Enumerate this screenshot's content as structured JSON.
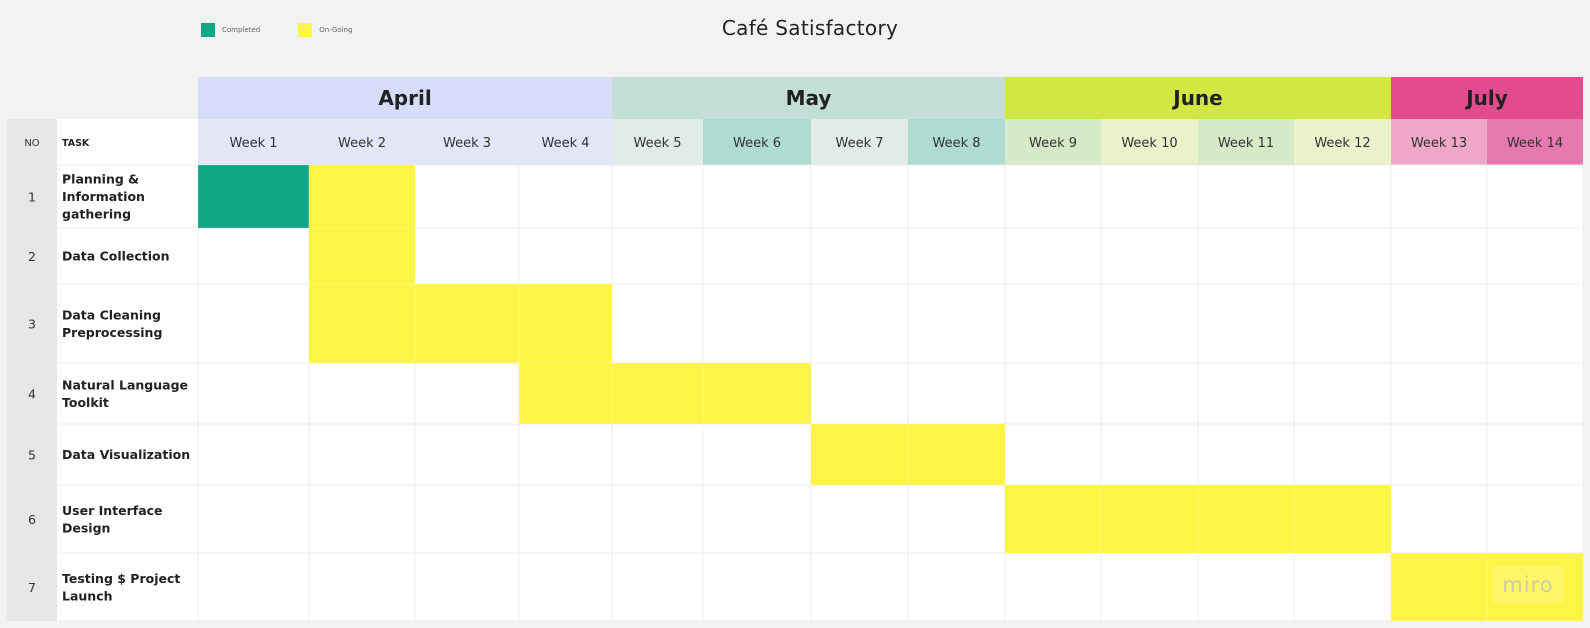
{
  "legend": {
    "completed": {
      "label": "Completed",
      "color": "#0ea886"
    },
    "ongoing": {
      "label": "On-Going",
      "color": "#fef445"
    }
  },
  "chart_data": {
    "type": "gantt",
    "title": "Café Satisfactory",
    "columns": {
      "no": "NO",
      "task": "TASK"
    },
    "months": [
      {
        "name": "April",
        "weeks": 4,
        "color": "#d6dcf9",
        "week_colors": [
          "#e3e6f7",
          "#e3e6f7",
          "#e3e6f7",
          "#e3e6f7"
        ]
      },
      {
        "name": "May",
        "weeks": 4,
        "color": "#c3dfd7",
        "week_colors": [
          "#e1ece8",
          "#aedcd0",
          "#e1ece8",
          "#aedcd0"
        ]
      },
      {
        "name": "June",
        "weeks": 4,
        "color": "#d0e744",
        "week_colors": [
          "#d6eac8",
          "#e9f2cb",
          "#d6eac8",
          "#e9f2cb"
        ]
      },
      {
        "name": "July",
        "weeks": 2,
        "color": "#e24b8f",
        "week_colors": [
          "#eea7c7",
          "#e67aae"
        ]
      }
    ],
    "weeks": [
      "Week 1",
      "Week 2",
      "Week 3",
      "Week 4",
      "Week 5",
      "Week 6",
      "Week 7",
      "Week 8",
      "Week 9",
      "Week 10",
      "Week 11",
      "Week 12",
      "Week 13",
      "Week 14"
    ],
    "tasks": [
      {
        "no": "1",
        "name": "Planning & Information gathering",
        "segments": [
          {
            "status": "completed",
            "weeks": [
              1
            ]
          },
          {
            "status": "ongoing",
            "weeks": [
              2
            ]
          }
        ]
      },
      {
        "no": "2",
        "name": "Data Collection",
        "segments": [
          {
            "status": "ongoing",
            "weeks": [
              2
            ]
          }
        ]
      },
      {
        "no": "3",
        "name": "Data Cleaning Preprocessing",
        "segments": [
          {
            "status": "ongoing",
            "weeks": [
              2,
              3,
              4
            ]
          }
        ]
      },
      {
        "no": "4",
        "name": "Natural Language Toolkit",
        "segments": [
          {
            "status": "ongoing",
            "weeks": [
              4,
              5,
              6
            ]
          }
        ]
      },
      {
        "no": "5",
        "name": "Data Visualization",
        "segments": [
          {
            "status": "ongoing",
            "weeks": [
              7,
              8
            ]
          }
        ]
      },
      {
        "no": "6",
        "name": "User Interface Design",
        "segments": [
          {
            "status": "ongoing",
            "weeks": [
              9,
              10,
              11,
              12
            ]
          }
        ]
      },
      {
        "no": "7",
        "name": "Testing $ Project Launch",
        "segments": [
          {
            "status": "ongoing",
            "weeks": [
              13,
              14
            ]
          }
        ]
      }
    ]
  },
  "watermark": "miro"
}
